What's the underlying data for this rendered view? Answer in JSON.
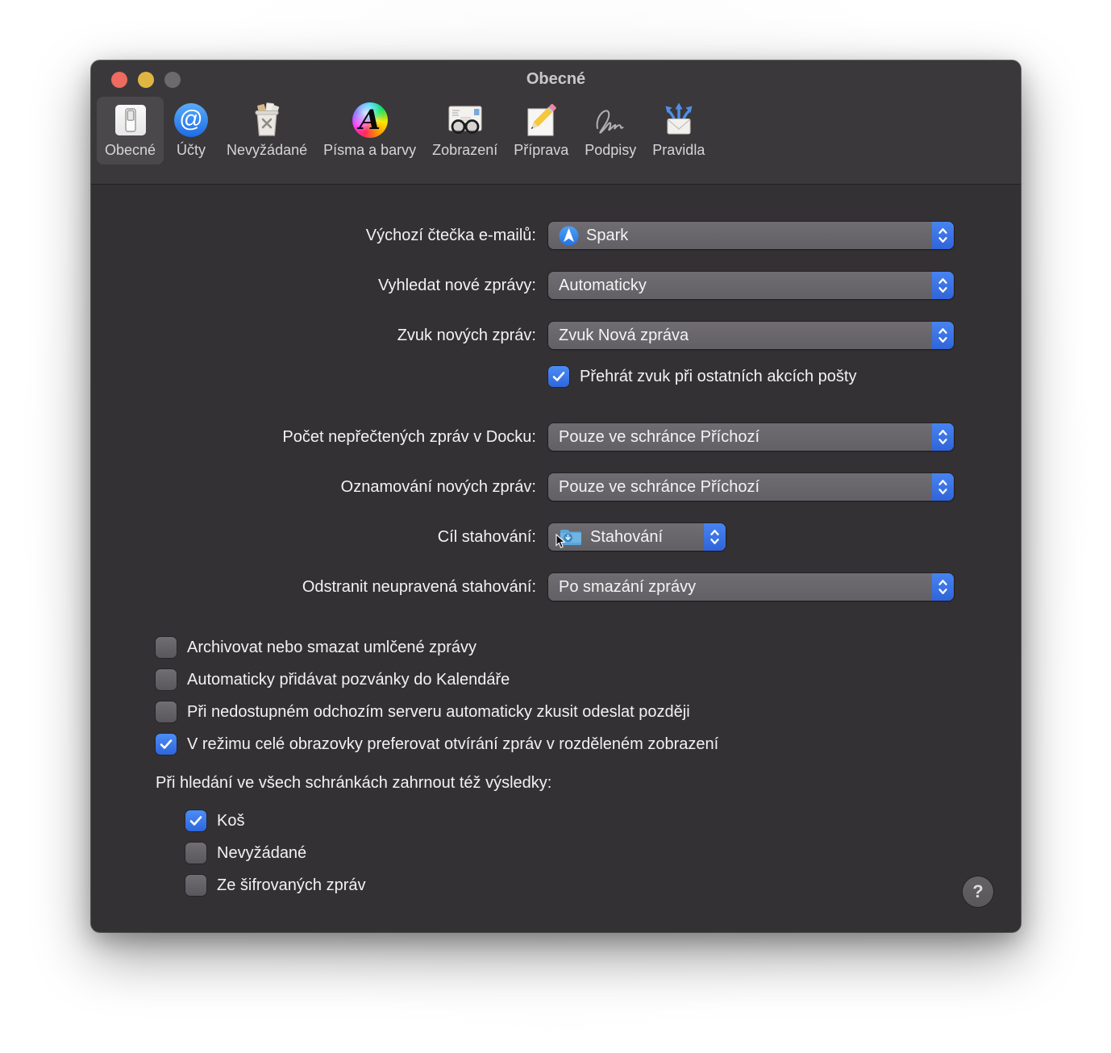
{
  "window": {
    "title": "Obecné"
  },
  "toolbar": {
    "items": [
      {
        "label": "Obecné",
        "selected": true
      },
      {
        "label": "Účty",
        "selected": false
      },
      {
        "label": "Nevyžádané",
        "selected": false
      },
      {
        "label": "Písma a barvy",
        "selected": false
      },
      {
        "label": "Zobrazení",
        "selected": false
      },
      {
        "label": "Příprava",
        "selected": false
      },
      {
        "label": "Podpisy",
        "selected": false
      },
      {
        "label": "Pravidla",
        "selected": false
      }
    ],
    "fonts_icon_letter": "A"
  },
  "form": {
    "rows": [
      {
        "label": "Výchozí čtečka e-mailů:",
        "value": "Spark"
      },
      {
        "label": "Vyhledat nové zprávy:",
        "value": "Automaticky"
      },
      {
        "label": "Zvuk nových zpráv:",
        "value": "Zvuk Nová zpráva"
      },
      {
        "label": "Počet nepřečtených zpráv v Docku:",
        "value": "Pouze ve schránce Příchozí"
      },
      {
        "label": "Oznamování nových zpráv:",
        "value": "Pouze ve schránce Příchozí"
      },
      {
        "label": "Cíl stahování:",
        "value": "Stahování"
      },
      {
        "label": "Odstranit neupravená stahování:",
        "value": "Po smazání zprávy"
      }
    ],
    "sound_checkbox": {
      "label": "Přehrát zvuk při ostatních akcích pošty",
      "checked": true
    },
    "checkboxes": [
      {
        "label": "Archivovat nebo smazat umlčené zprávy",
        "checked": false
      },
      {
        "label": "Automaticky přidávat pozvánky do Kalendáře",
        "checked": false
      },
      {
        "label": "Při nedostupném odchozím serveru automaticky zkusit odeslat později",
        "checked": false
      },
      {
        "label": "V režimu celé obrazovky preferovat otvírání zpráv v rozděleném zobrazení",
        "checked": true
      }
    ],
    "search": {
      "heading": "Při hledání ve všech schránkách zahrnout též výsledky:",
      "items": [
        {
          "label": "Koš",
          "checked": true
        },
        {
          "label": "Nevyžádané",
          "checked": false
        },
        {
          "label": "Ze šifrovaných zpráv",
          "checked": false
        }
      ]
    }
  },
  "help_label": "?",
  "colors": {
    "accent": "#3a77e2",
    "window_bg": "#343134",
    "header_bg": "#3b383b",
    "popup_gray": "#686668"
  }
}
